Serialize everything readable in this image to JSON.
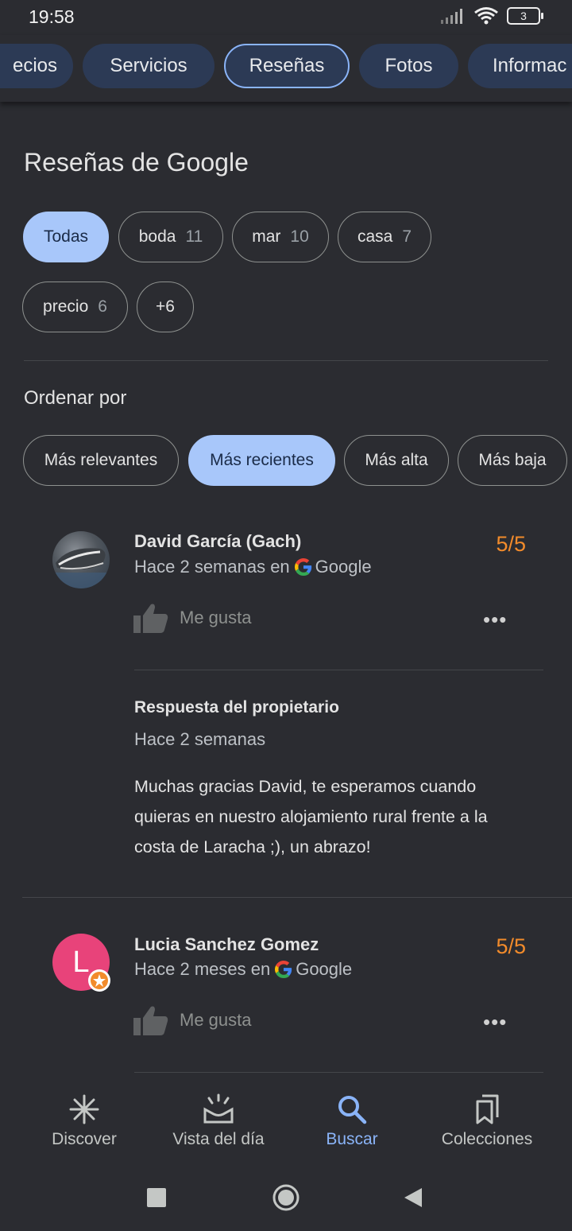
{
  "status": {
    "time": "19:58",
    "battery": "3"
  },
  "tabs": [
    {
      "label": "ecios"
    },
    {
      "label": "Servicios"
    },
    {
      "label": "Reseñas"
    },
    {
      "label": "Fotos"
    },
    {
      "label": "Informac"
    }
  ],
  "reviews_section": {
    "title": "Reseñas de Google",
    "filters": [
      {
        "label": "Todas",
        "count": ""
      },
      {
        "label": "boda",
        "count": "11"
      },
      {
        "label": "mar",
        "count": "10"
      },
      {
        "label": "casa",
        "count": "7"
      },
      {
        "label": "precio",
        "count": "6"
      },
      {
        "label": "+6",
        "count": ""
      }
    ],
    "sort_label": "Ordenar por",
    "sort_options": [
      "Más relevantes",
      "Más recientes",
      "Más alta",
      "Más baja"
    ]
  },
  "reviews": [
    {
      "name": "David García (Gach)",
      "time": "Hace 2 semanas en",
      "source": "Google",
      "rating": "5/5",
      "like_label": "Me gusta",
      "more": "•••",
      "owner_reply": {
        "title": "Respuesta del propietario",
        "time": "Hace 2 semanas",
        "text": "Muchas gracias David, te esperamos cuando quieras en nuestro alojamiento rural frente a la costa de Laracha ;), un abrazo!"
      }
    },
    {
      "name": "Lucia Sanchez Gomez",
      "avatar_letter": "L",
      "time": "Hace 2 meses en",
      "source": "Google",
      "rating": "5/5",
      "like_label": "Me gusta",
      "more": "•••"
    }
  ],
  "bottom_nav": [
    {
      "label": "Discover",
      "icon": "asterisk-icon"
    },
    {
      "label": "Vista del día",
      "icon": "sunrise-icon"
    },
    {
      "label": "Buscar",
      "icon": "search-icon"
    },
    {
      "label": "Colecciones",
      "icon": "bookmarks-icon"
    }
  ],
  "colors": {
    "accent": "#8ab4f8",
    "rating": "#f28b2b",
    "background": "#2b2c31",
    "tab_bg": "#2c3a55",
    "chip_selected": "#a8c7fa"
  }
}
